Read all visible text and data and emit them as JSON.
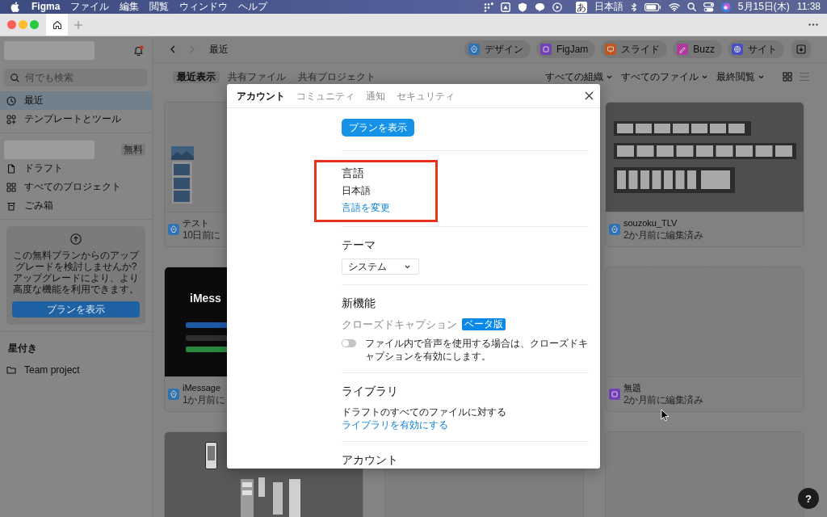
{
  "menu_bar": {
    "app_name": "Figma",
    "menus": [
      "ファイル",
      "編集",
      "閲覧",
      "ウィンドウ",
      "ヘルプ"
    ],
    "input_source": "あ",
    "input_language": "日本語",
    "date": "5月15日(木)",
    "time": "11:38"
  },
  "tab_bar": {
    "tabs": [
      {
        "kind": "home",
        "selected": true
      }
    ]
  },
  "sidebar": {
    "notification_unread": true,
    "search": {
      "placeholder": "何でも検索"
    },
    "nav": [
      {
        "label": "最近",
        "kind": "clock",
        "selected": true
      },
      {
        "label": "テンプレートとツール",
        "kind": "apps",
        "selected": false
      }
    ],
    "plan_badge": "無料",
    "team_nav": [
      {
        "label": "ドラフト",
        "kind": "file",
        "selected": false
      },
      {
        "label": "すべてのプロジェクト",
        "kind": "projects",
        "selected": false
      },
      {
        "label": "ごみ箱",
        "kind": "trash",
        "selected": false
      }
    ],
    "upgrade": {
      "text": "この無料プランからのアップグレードを検討しませんか? アップグレードにより、より高度な機能を利用できます。",
      "button": "プランを表示"
    },
    "starred": {
      "title": "星付き",
      "items": [
        {
          "label": "Team project"
        }
      ]
    }
  },
  "header": {
    "nav_buttons": [
      {
        "kind": "back",
        "disabled": false
      },
      {
        "kind": "forward",
        "disabled": true
      }
    ],
    "title": "最近",
    "products": [
      {
        "label": "デザイン",
        "kind": "design",
        "color": "#2f73b3"
      },
      {
        "label": "FigJam",
        "kind": "figjam",
        "color": "#7340b8"
      },
      {
        "label": "スライド",
        "kind": "slides",
        "color": "#c0561e"
      },
      {
        "label": "Buzz",
        "kind": "buzz",
        "color": "#b0399c"
      },
      {
        "label": "サイト",
        "kind": "sites",
        "color": "#4a4fc0"
      }
    ]
  },
  "filters": {
    "tabs": [
      {
        "label": "最近表示",
        "selected": true
      },
      {
        "label": "共有ファイル",
        "selected": false
      },
      {
        "label": "共有プロジェクト",
        "selected": false
      }
    ],
    "dropdowns": [
      "すべての組織",
      "すべてのファイル",
      "最終閲覧"
    ],
    "views": [
      {
        "kind": "grid",
        "selected": true
      },
      {
        "kind": "list",
        "selected": false
      }
    ]
  },
  "file_columns": [
    {
      "files": [
        {
          "preview": {
            "kind": "photos"
          },
          "kind": "design",
          "title": "テスト",
          "edited": "10日前に"
        },
        {
          "preview": {
            "kind": "dark",
            "text": "iMess"
          },
          "kind": "design",
          "title": "iMessage",
          "edited": "1か月前に"
        },
        {
          "preview": {
            "kind": "phones"
          }
        }
      ]
    },
    {
      "files": [
        {
          "preview": {
            "kind": "blank"
          }
        }
      ]
    },
    {
      "files": [
        {
          "preview": {
            "kind": "slides"
          },
          "kind": "design",
          "title": "souzoku_TLV",
          "edited": "2か月前に編集済み"
        },
        {
          "preview": {
            "kind": "blank"
          },
          "kind": "figjam",
          "title": "無題",
          "edited": "2か月前に編集済み"
        },
        {
          "preview": {
            "kind": "blank"
          }
        }
      ]
    }
  ],
  "dialog": {
    "tabs": [
      {
        "label": "アカウント",
        "selected": true
      },
      {
        "label": "コミュニティ",
        "selected": false
      },
      {
        "label": "通知",
        "selected": false
      },
      {
        "label": "セキュリティ",
        "selected": false
      }
    ],
    "plan_button": "プランを表示",
    "language": {
      "title": "言語",
      "value": "日本語",
      "link": "言語を変更",
      "highlighted": true
    },
    "theme": {
      "title": "テーマ",
      "value": "システム"
    },
    "new_features": {
      "title": "新機能",
      "feature": "クローズドキャプション",
      "badge": "ベータ版",
      "toggle_on": false,
      "description": "ファイル内で音声を使用する場合は、クローズドキャプションを有効にします。"
    },
    "library": {
      "title": "ライブラリ",
      "text": "ドラフトのすべてのファイルに対する",
      "link": "ライブラリを有効にする"
    },
    "account": {
      "title": "アカウント"
    }
  },
  "help_button": "?"
}
